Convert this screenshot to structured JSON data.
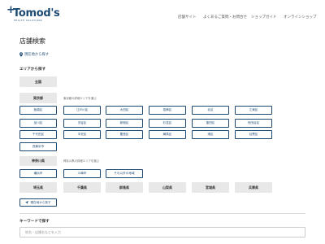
{
  "header": {
    "logo_text": "Tomod's",
    "logo_plus": "+",
    "logo_sub": "HEALTH SOLUTIONS",
    "nav": [
      "店舗サイト",
      "よくあるご質問・お問合せ",
      "ショップガイド",
      "オンラインショップ"
    ]
  },
  "page": {
    "title": "店舗検索",
    "current_location": "現在地から探す"
  },
  "area": {
    "label": "エリアから探す",
    "all": "全国",
    "tokyo": {
      "label": "東京都",
      "caption": "東京都の詳細エリアを選ぶ",
      "wards": [
        "板橋区",
        "江戸川区",
        "大田区",
        "葛飾区",
        "北区",
        "江東区",
        "品川区",
        "渋谷区",
        "新宿区",
        "杉並区",
        "墨田区",
        "世田谷区",
        "千代田区",
        "中央区",
        "豊島区",
        "練馬区",
        "港区",
        "目黒区",
        "西東京市"
      ]
    },
    "kanagawa": {
      "label": "神奈川県",
      "caption": "神奈川県の詳細エリアを選ぶ",
      "cities": [
        "横浜市",
        "川崎市",
        "それ以外の地域"
      ]
    },
    "prefectures": [
      "埼玉県",
      "千葉県",
      "群馬県",
      "山梨県",
      "宮城県",
      "兵庫県"
    ],
    "geo_button": "現在地から探す"
  },
  "keyword": {
    "label": "キーワードで探す",
    "placeholder": "地名・店舗名などを入力"
  },
  "colors": {
    "brand": "#1d4a73",
    "gray_button": "#e8e8e8"
  }
}
